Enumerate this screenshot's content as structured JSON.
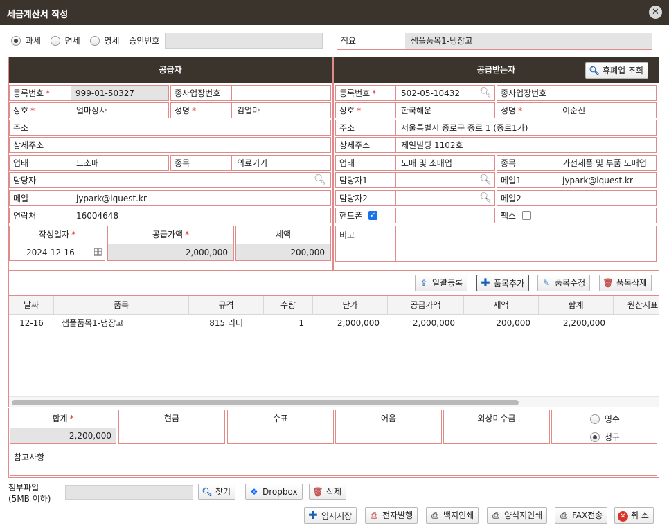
{
  "window": {
    "title": "세금계산서 작성"
  },
  "tax_type": {
    "options": [
      "과세",
      "면세",
      "영세"
    ],
    "selected": "과세",
    "approval_label": "승인번호",
    "approval_value": ""
  },
  "memo": {
    "label": "적요",
    "value": "샘플품목1-냉장고"
  },
  "supplier": {
    "header": "공급자",
    "reg_no_label": "등록번호",
    "reg_no": "999-01-50327",
    "branch_label": "종사업장번호",
    "branch": "",
    "name_label": "상호",
    "name": "얼마상사",
    "ceo_label": "성명",
    "ceo": "김얼마",
    "addr_label": "주소",
    "addr": "",
    "addr2_label": "상세주소",
    "addr2": "",
    "biz_type_label": "업태",
    "biz_type": "도소매",
    "biz_item_label": "종목",
    "biz_item": "의료기기",
    "contact_label": "담당자",
    "contact": "",
    "email_label": "메일",
    "email": "jypark@iquest.kr",
    "phone_label": "연락처",
    "phone": "16004648"
  },
  "summary": {
    "date_label": "작성일자",
    "date": "2024-12-16",
    "supply_label": "공급가액",
    "supply": "2,000,000",
    "tax_label": "세액",
    "tax": "200,000"
  },
  "receiver": {
    "header": "공급받는자",
    "closure_btn": "휴폐업 조회",
    "reg_no_label": "등록번호",
    "reg_no": "502-05-10432",
    "branch_label": "종사업장번호",
    "branch": "",
    "name_label": "상호",
    "name": "한국해운",
    "ceo_label": "성명",
    "ceo": "이순신",
    "addr_label": "주소",
    "addr": "서울특별시 종로구 종로 1 (종로1가)",
    "addr2_label": "상세주소",
    "addr2": "제일빌딩 1102호",
    "biz_type_label": "업태",
    "biz_type": "도매 및 소매업",
    "biz_item_label": "종목",
    "biz_item": "가전제품 및 부품 도매업",
    "contact1_label": "담당자1",
    "contact1": "",
    "email1_label": "메일1",
    "email1": "jypark@iquest.kr",
    "contact2_label": "담당자2",
    "contact2": "",
    "email2_label": "메일2",
    "email2": "",
    "mobile_label": "핸드폰",
    "mobile_checked": true,
    "mobile": "",
    "fax_label": "팩스",
    "fax_checked": false,
    "fax": "",
    "note_label": "비고",
    "note": ""
  },
  "item_buttons": {
    "bulk": "일괄등록",
    "add": "품목추가",
    "edit": "품목수정",
    "delete": "품목삭제"
  },
  "items_table": {
    "columns": [
      "날짜",
      "품목",
      "규격",
      "수량",
      "단가",
      "공급가액",
      "세액",
      "합계",
      "원산지표"
    ],
    "rows": [
      [
        "12-16",
        "샘플품목1-냉장고",
        "815 리터",
        "1",
        "2,000,000",
        "2,000,000",
        "200,000",
        "2,200,000",
        ""
      ]
    ]
  },
  "totals": {
    "total_label": "합계",
    "total": "2,200,000",
    "cash_label": "현금",
    "cash": "",
    "check_label": "수표",
    "check": "",
    "note_label": "어음",
    "note": "",
    "credit_label": "외상미수금",
    "credit": "",
    "receipt_label": "영수",
    "claim_label": "청구",
    "selected": "청구"
  },
  "remarks": {
    "label": "참고사항",
    "value": ""
  },
  "attachment": {
    "label": "첨부파일",
    "sub_label": "(5MB 이하)",
    "find": "찾기",
    "dropbox": "Dropbox",
    "delete": "삭제"
  },
  "footer": {
    "temp_save": "임시저장",
    "e_issue": "전자발행",
    "blank_print": "백지인쇄",
    "form_print": "양식지인쇄",
    "fax_send": "FAX전송",
    "cancel": "취 소"
  },
  "colors": {
    "titlebar": "#3b342c",
    "border": "#e08a8a",
    "required": "#d33333",
    "accent_blue": "#1a73e8"
  }
}
